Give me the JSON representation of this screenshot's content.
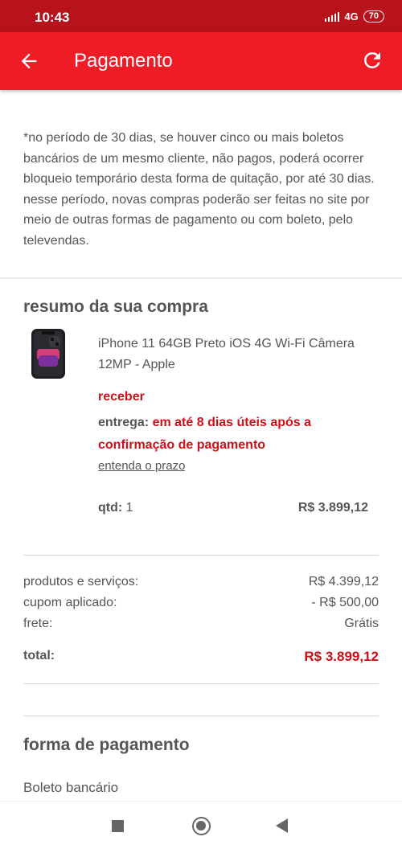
{
  "status_bar": {
    "time": "10:43",
    "network": "4G",
    "battery": "70"
  },
  "app_bar": {
    "title": "Pagamento"
  },
  "notice": {
    "text": "*no período de 30 dias, se houver cinco ou mais boletos bancários de um mesmo cliente, não pagos, poderá ocorrer bloqueio temporário desta forma de quitação, por até 30 dias. nesse período, novas compras poderão ser feitas no site por meio de outras formas de pagamento ou com boleto, pelo televendas."
  },
  "summary": {
    "title": "resumo da sua compra",
    "product": {
      "name": "iPhone 11 64GB Preto iOS 4G Wi-Fi Câmera 12MP - Apple",
      "receive_label": "receber",
      "delivery_label": "entrega:",
      "delivery_text": "em até 8 dias úteis após a confirmação de pagamento",
      "prazo_link": "entenda o prazo",
      "qty_label": "qtd:",
      "qty_value": "1",
      "price": "R$ 3.899,12"
    },
    "rows": {
      "products_label": "produtos e serviços:",
      "products_value": "R$ 4.399,12",
      "coupon_label": "cupom aplicado:",
      "coupon_value": "- R$ 500,00",
      "shipping_label": "frete:",
      "shipping_value": "Grátis",
      "total_label": "total:",
      "total_value": "R$ 3.899,12"
    }
  },
  "payment": {
    "title": "forma de pagamento",
    "method": "Boleto bancário"
  },
  "colors": {
    "status_bar": "#b8121a",
    "app_bar": "#ee1c25",
    "accent_red": "#cc0f18"
  }
}
